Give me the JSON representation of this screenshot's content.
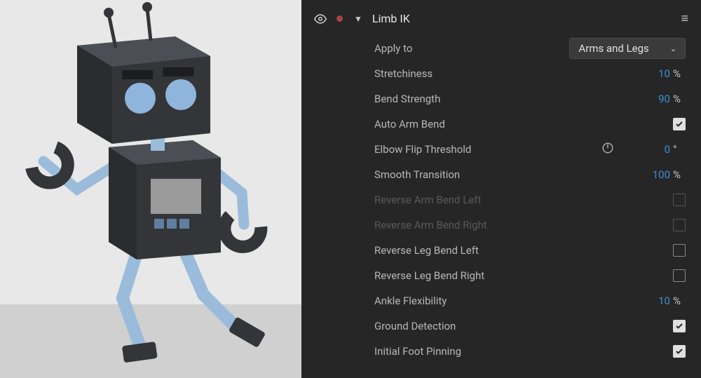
{
  "panel": {
    "title": "Limb IK"
  },
  "properties": {
    "apply_to": {
      "label": "Apply to",
      "value": "Arms and Legs"
    },
    "stretchiness": {
      "label": "Stretchiness",
      "value": "10",
      "unit": "%"
    },
    "bend_strength": {
      "label": "Bend Strength",
      "value": "90",
      "unit": "%"
    },
    "auto_arm_bend": {
      "label": "Auto Arm Bend"
    },
    "elbow_flip_threshold": {
      "label": "Elbow Flip Threshold",
      "value": "0",
      "unit": "°"
    },
    "smooth_transition": {
      "label": "Smooth Transition",
      "value": "100",
      "unit": "%"
    },
    "reverse_arm_bend_left": {
      "label": "Reverse Arm Bend Left"
    },
    "reverse_arm_bend_right": {
      "label": "Reverse Arm Bend Right"
    },
    "reverse_leg_bend_left": {
      "label": "Reverse Leg Bend Left"
    },
    "reverse_leg_bend_right": {
      "label": "Reverse Leg Bend Right"
    },
    "ankle_flexibility": {
      "label": "Ankle Flexibility",
      "value": "10",
      "unit": "%"
    },
    "ground_detection": {
      "label": "Ground Detection"
    },
    "initial_foot_pinning": {
      "label": "Initial Foot Pinning"
    }
  }
}
